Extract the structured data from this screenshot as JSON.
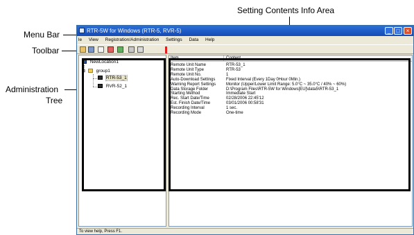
{
  "callouts": {
    "menu_bar": "Menu Bar",
    "toolbar": "Toolbar",
    "admin_tree_line1": "Administration",
    "admin_tree_line2": "Tree",
    "setting_contents": "Setting Contents Info Area"
  },
  "window": {
    "title": "RTR-5W for Windows (RTR-5, RVR-5)",
    "menu": [
      "le",
      "View",
      "Registration/Administration",
      "Settings",
      "Data",
      "Help"
    ],
    "status": "To view help, Press F1."
  },
  "toolbar": {
    "icons": [
      "folder-open-icon",
      "grid-icon",
      "document-icon",
      "record-icon",
      "connect-icon",
      "print-icon",
      "chart-icon",
      "alert-icon"
    ]
  },
  "tree": {
    "root": "NewLocation1",
    "group": "group1",
    "units": [
      "RTR-53_1",
      "RVR-52_1"
    ]
  },
  "info": {
    "header_item": "Item",
    "header_content": "Content",
    "rows": [
      {
        "item": "Remote Unit Name",
        "content": "RTR-53_1"
      },
      {
        "item": "Remote Unit Type",
        "content": "RTR-53"
      },
      {
        "item": "Remote Unit No.",
        "content": "1"
      },
      {
        "item": "Auto-Download Settings",
        "content": "Fixed Interval (Every 1Day 0Hour 0Min.)"
      },
      {
        "item": "Warning Report Settings",
        "content": "Monitor (Upper/Lower Limit Range: 5.0°C ~ 35.0°C / 40% ~ 60%)"
      },
      {
        "item": "Data Storage Folder",
        "content": "D:\\Program Files\\RTR-5W for Windows[EU]\\data5\\RTR-53_1"
      },
      {
        "item": "Starting Method",
        "content": "Immediate Start"
      },
      {
        "item": "Rec. Start Date/Time",
        "content": "02/28/2006 22:45'12"
      },
      {
        "item": "Est. Finish Date/Time",
        "content": "03/01/2006 00:58'31"
      },
      {
        "item": "Recording Interval",
        "content": "1 sec."
      },
      {
        "item": "Recording Mode",
        "content": "One-time"
      }
    ]
  }
}
